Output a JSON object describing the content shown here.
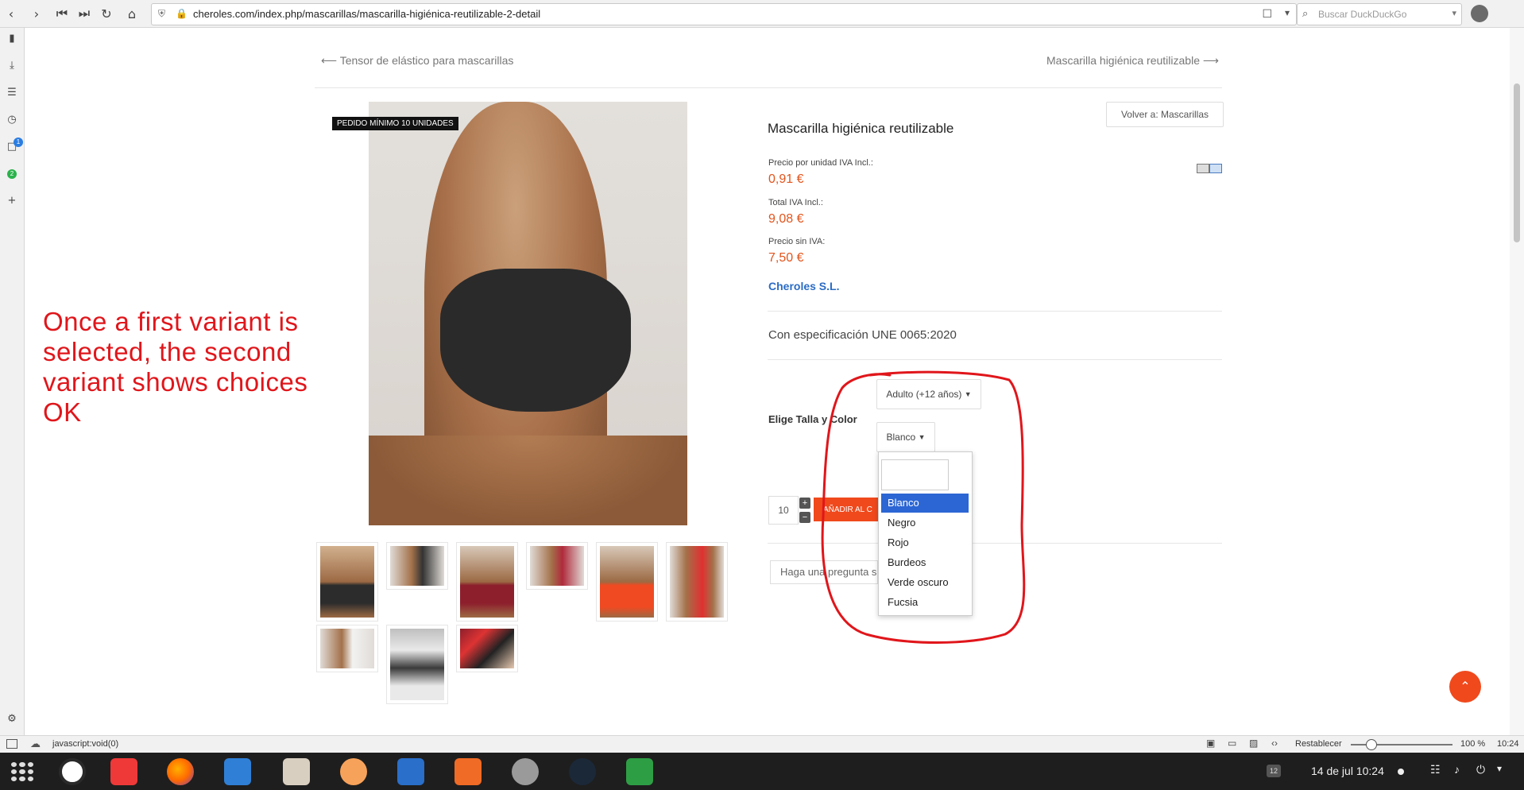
{
  "browser": {
    "url": "cheroles.com/index.php/mascarillas/mascarilla-higiénica-reutilizable-2-detail",
    "search_placeholder": "Buscar DuckDuckGo",
    "left_panel_badges": [
      "1",
      "2"
    ]
  },
  "nav": {
    "prev_label": "Tensor de elástico para mascarillas",
    "next_label": "Mascarilla higiénica reutilizable",
    "back_button": "Volver a: Mascarillas"
  },
  "product": {
    "badge": "PEDIDO MÍNIMO 10 UNIDADES",
    "title": "Mascarilla higiénica reutilizable",
    "unit_price_label": "Precio por unidad IVA Incl.:",
    "unit_price": "0,91 €",
    "total_label": "Total IVA Incl.:",
    "total": "9,08 €",
    "net_label": "Precio sin IVA:",
    "net": "7,50 €",
    "vendor": "Cheroles S.L.",
    "spec": "Con especificación UNE 0065:2020",
    "variant_label": "Elige Talla y Color",
    "size_selected": "Adulto (+12 años)",
    "color_selected": "Blanco",
    "quantity": "10",
    "add_to_cart": "AÑADIR AL C",
    "question_placeholder": "Haga una pregunta s"
  },
  "dropdown": {
    "options": [
      "Blanco",
      "Negro",
      "Rojo",
      "Burdeos",
      "Verde oscuro",
      "Fucsia"
    ],
    "selected_index": 0
  },
  "annotation": {
    "text": "Once a first variant is selected, the second variant shows choices OK",
    "color": "#e0161b"
  },
  "statusbar": {
    "link": "javascript:void(0)",
    "reset_label": "Restablecer",
    "zoom": "100 %",
    "time": "10:24"
  },
  "taskbar": {
    "date_time": "14 de jul  10:24",
    "workspace": "12"
  },
  "colors": {
    "accent": "#e2541c",
    "vendor_link": "#2b6cc4",
    "selection": "#2c66d4"
  }
}
